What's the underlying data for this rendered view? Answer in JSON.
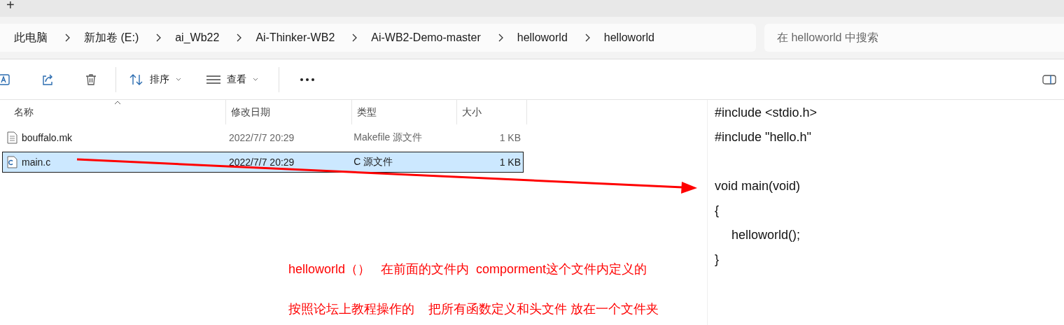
{
  "new_tab": "+",
  "breadcrumb": [
    "此电脑",
    "新加卷 (E:)",
    "ai_Wb22",
    "Ai-Thinker-WB2",
    "Ai-WB2-Demo-master",
    "helloworld",
    "helloworld"
  ],
  "search": {
    "placeholder": "在 helloworld 中搜索"
  },
  "toolbar": [
    {
      "kind": "rename"
    },
    {
      "kind": "share"
    },
    {
      "kind": "delete"
    },
    {
      "kind": "sort",
      "label": "排序"
    },
    {
      "kind": "view",
      "label": "查看"
    },
    {
      "kind": "more"
    }
  ],
  "columns": [
    "名称",
    "修改日期",
    "类型",
    "大小"
  ],
  "rows": [
    {
      "kind": "text",
      "name": "bouffalo.mk",
      "date": "2022/7/7 20:29",
      "type": "Makefile 源文件",
      "size": "1 KB",
      "selected": false
    },
    {
      "kind": "c",
      "name": "main.c",
      "date": "2022/7/7 20:29",
      "type": "C 源文件",
      "size": "1 KB",
      "selected": true
    }
  ],
  "code_blocks": [
    {
      "lines": [
        {
          "text": "#include <stdio.h>",
          "indent": false
        },
        {
          "text": "#include \"hello.h\"",
          "indent": false
        }
      ]
    },
    {
      "lines": [
        {
          "text": "void main(void)",
          "indent": false
        },
        {
          "text": "{",
          "indent": false
        },
        {
          "text": "helloworld();",
          "indent": true
        },
        {
          "text": "}",
          "indent": false
        }
      ]
    }
  ],
  "annotations": [
    "helloworld（）   在前面的文件内  comporment这个文件内定义的",
    "按照论坛上教程操作的    把所有函数定义和头文件 放在一个文件夹"
  ]
}
